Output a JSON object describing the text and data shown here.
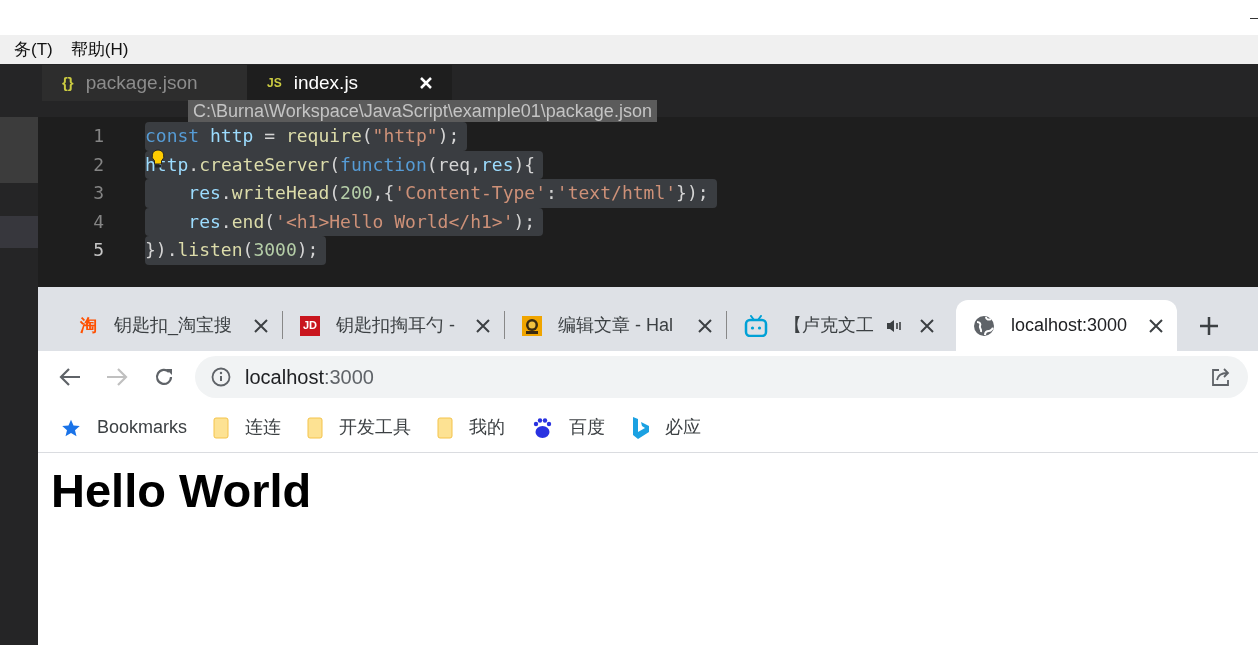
{
  "menu_bar": {
    "items": [
      "务(T)",
      "帮助(H)"
    ]
  },
  "editor": {
    "tabs": [
      {
        "label": "package.json",
        "kind": "json",
        "icon_text": "{}",
        "selected": false,
        "closable": false
      },
      {
        "label": "index.js",
        "kind": "js",
        "icon_text": "JS",
        "selected": true,
        "closable": true
      }
    ],
    "tooltip": "C:\\Burna\\Workspace\\JavaScript\\example01\\package.json",
    "lines": [
      {
        "number": "1",
        "current": false,
        "selected": true,
        "hint": false,
        "tokens": [
          {
            "kind": "keyword",
            "text": "const"
          },
          {
            "kind": "variable",
            "text": " http"
          },
          {
            "kind": "plain",
            "text": " = "
          },
          {
            "kind": "function",
            "text": "require"
          },
          {
            "kind": "plain",
            "text": "("
          },
          {
            "kind": "string",
            "text": "\"http\""
          },
          {
            "kind": "plain",
            "text": ");"
          }
        ]
      },
      {
        "number": "2",
        "current": false,
        "selected": true,
        "hint": true,
        "tokens": [
          {
            "kind": "variable",
            "text": "http"
          },
          {
            "kind": "plain",
            "text": "."
          },
          {
            "kind": "function",
            "text": "createServer"
          },
          {
            "kind": "plain",
            "text": "("
          },
          {
            "kind": "keyword",
            "text": "function"
          },
          {
            "kind": "plain",
            "text": "(req,"
          },
          {
            "kind": "variable",
            "text": "res"
          },
          {
            "kind": "plain",
            "text": "){"
          }
        ]
      },
      {
        "number": "3",
        "current": false,
        "selected": true,
        "hint": false,
        "tokens": [
          {
            "kind": "variable",
            "text": "    res"
          },
          {
            "kind": "plain",
            "text": "."
          },
          {
            "kind": "function",
            "text": "writeHead"
          },
          {
            "kind": "plain",
            "text": "("
          },
          {
            "kind": "number",
            "text": "200"
          },
          {
            "kind": "plain",
            "text": ",{"
          },
          {
            "kind": "string",
            "text": "'Content-Type'"
          },
          {
            "kind": "plain",
            "text": ":"
          },
          {
            "kind": "string",
            "text": "'text/html'"
          },
          {
            "kind": "plain",
            "text": "});"
          }
        ]
      },
      {
        "number": "4",
        "current": false,
        "selected": true,
        "hint": false,
        "tokens": [
          {
            "kind": "variable",
            "text": "    res"
          },
          {
            "kind": "plain",
            "text": "."
          },
          {
            "kind": "function",
            "text": "end"
          },
          {
            "kind": "plain",
            "text": "("
          },
          {
            "kind": "string",
            "text": "'<h1>Hello World</h1>'"
          },
          {
            "kind": "plain",
            "text": ");"
          }
        ]
      },
      {
        "number": "5",
        "current": true,
        "selected": true,
        "hint": false,
        "tokens": [
          {
            "kind": "plain",
            "text": "})."
          },
          {
            "kind": "function",
            "text": "listen"
          },
          {
            "kind": "plain",
            "text": "("
          },
          {
            "kind": "number",
            "text": "3000"
          },
          {
            "kind": "plain",
            "text": ");"
          }
        ]
      }
    ]
  },
  "browser": {
    "tabs": [
      {
        "title": "钥匙扣_淘宝搜",
        "kind": "glyph",
        "favicon_text": "淘",
        "selected": false,
        "audio": false
      },
      {
        "title": "钥匙扣掏耳勺 -",
        "kind": "badge",
        "favicon_text": "JD",
        "selected": false,
        "audio": false
      },
      {
        "title": "编辑文章 - Hal",
        "kind": "mascot",
        "selected": false,
        "audio": false
      },
      {
        "title": "【卢克文工",
        "kind": "tv",
        "selected": false,
        "audio": true
      },
      {
        "title": "localhost:3000",
        "kind": "globe",
        "selected": true,
        "audio": false
      }
    ],
    "address": {
      "host": "localhost",
      "port": ":3000"
    },
    "bookmarks": [
      {
        "label": "Bookmarks",
        "kind": "star"
      },
      {
        "label": "连连",
        "kind": "folder"
      },
      {
        "label": "开发工具",
        "kind": "folder"
      },
      {
        "label": "我的",
        "kind": "folder"
      },
      {
        "label": "百度",
        "kind": "paw"
      },
      {
        "label": "必应",
        "kind": "bing"
      }
    ],
    "page_heading": "Hello World"
  }
}
